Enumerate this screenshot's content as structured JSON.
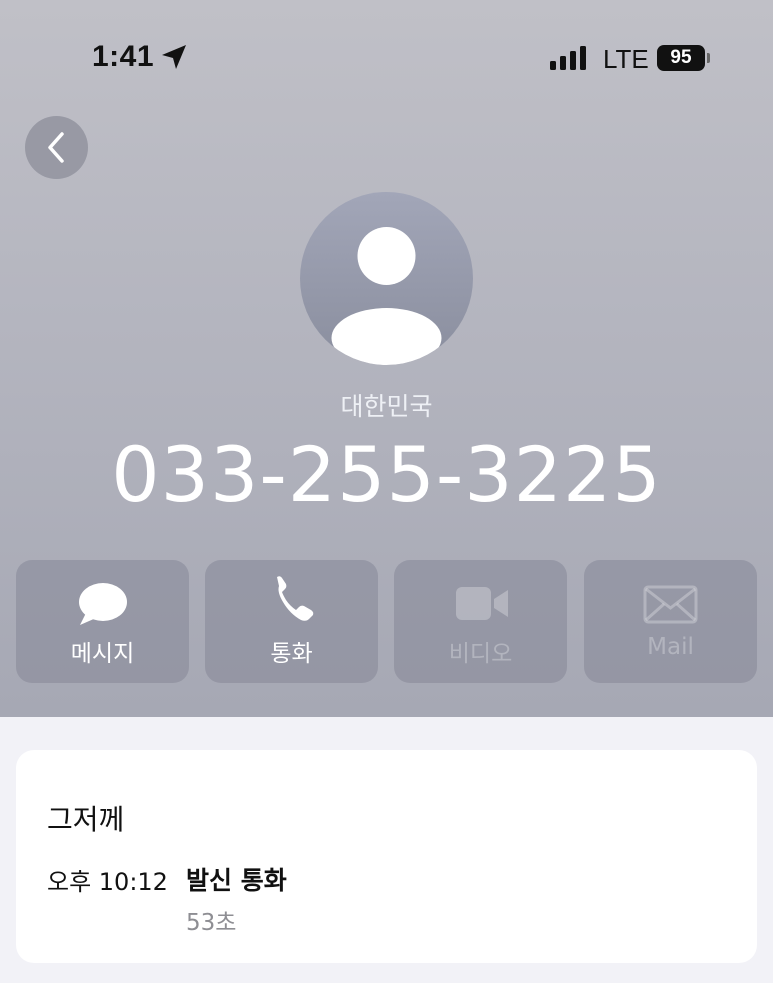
{
  "status_bar": {
    "time": "1:41",
    "network": "LTE",
    "battery": "95",
    "location_icon": "location-arrow-icon",
    "signal_icon": "cellular-signal-icon"
  },
  "contact": {
    "country": "대한민국",
    "phone_number": "033-255-3225",
    "avatar_icon": "person-silhouette-icon"
  },
  "navigation": {
    "back_icon": "chevron-left-icon"
  },
  "actions": [
    {
      "label": "메시지",
      "icon": "message-bubble-icon",
      "enabled": true
    },
    {
      "label": "통화",
      "icon": "phone-icon",
      "enabled": true
    },
    {
      "label": "비디오",
      "icon": "video-camera-icon",
      "enabled": false
    },
    {
      "label": "Mail",
      "icon": "envelope-icon",
      "enabled": false
    }
  ],
  "call_history": {
    "date": "그저께",
    "entries": [
      {
        "time": "오후 10:12",
        "type": "발신 통화",
        "duration": "53초"
      }
    ]
  },
  "colors": {
    "header_gradient_top": "#c0c0c7",
    "header_gradient_bottom": "#a6a8b4",
    "page_background": "#f2f2f7",
    "card_background": "#ffffff",
    "secondary_text": "#8e8e93"
  }
}
